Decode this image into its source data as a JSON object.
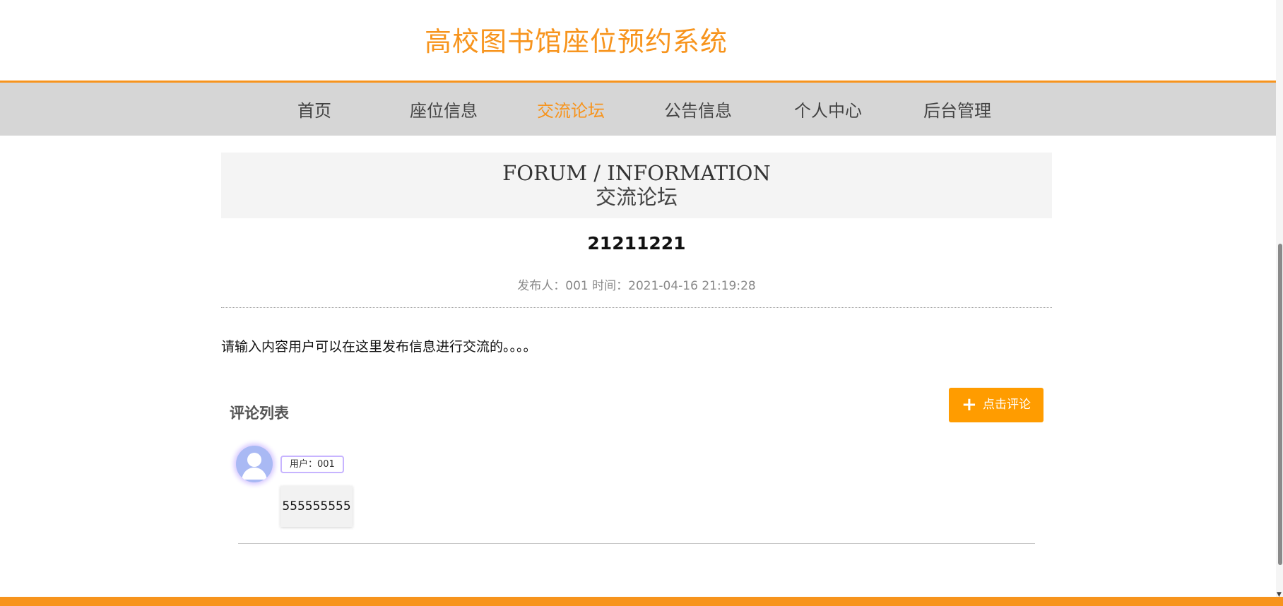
{
  "header": {
    "site_title": "高校图书馆座位预约系统"
  },
  "nav": {
    "items": [
      {
        "label": "首页",
        "active": false
      },
      {
        "label": "座位信息",
        "active": false
      },
      {
        "label": "交流论坛",
        "active": true
      },
      {
        "label": "公告信息",
        "active": false
      },
      {
        "label": "个人中心",
        "active": false
      },
      {
        "label": "后台管理",
        "active": false
      }
    ]
  },
  "banner": {
    "title_en": "FORUM / INFORMATION",
    "title_cn": "交流论坛"
  },
  "post": {
    "title": "21211221",
    "meta": "发布人：001 时间：2021-04-16 21:19:28",
    "content": "请输入内容用户可以在这里发布信息进行交流的。。。。"
  },
  "comments": {
    "heading": "评论列表",
    "add_button": {
      "icon": "plus-icon",
      "label": "点击评论"
    },
    "items": [
      {
        "user": "用户：001",
        "text": "555555555"
      }
    ]
  },
  "colors": {
    "accent": "#f7941d",
    "button": "#ff9c00",
    "nav_bg": "#d6d6d6"
  }
}
